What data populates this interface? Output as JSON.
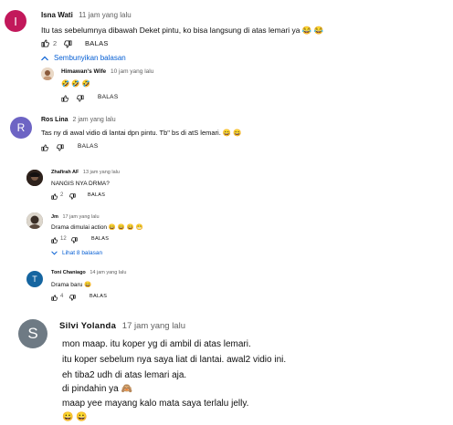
{
  "colors": {
    "link_blue": "#065fd4",
    "avatar_isna": "#c2185b",
    "avatar_ros": "#6d64c4",
    "avatar_toni": "#1565a0",
    "avatar_silvi": "#6e7a84",
    "meta_gray": "#606060"
  },
  "comments": [
    {
      "avatar_letter": "I",
      "author": "Isna Wati",
      "time": "11 jam yang lalu",
      "text": "Itu tas sebelumnya dibawah Deket pintu, ko bisa langsung di atas lemari ya 😂 😂",
      "likes": "2",
      "reply_label": "BALAS",
      "toggle_label": "Sembunyikan balasan",
      "toggle_icon": "chevron-up-icon",
      "replies": [
        {
          "author": "Himawan's Wife",
          "time": "10 jam yang lalu",
          "text": "🤣 🤣 🤣",
          "likes": "",
          "reply_label": "BALAS"
        }
      ]
    },
    {
      "avatar_letter": "R",
      "author": "Ros Lina",
      "time": "2 jam yang lalu",
      "text": "Tas ny di awal vidio di lantai dpn pintu. Tb\" bs di atS lemari.  😄 😄",
      "likes": "",
      "reply_label": "BALAS",
      "replies": [
        {
          "author": "Zhafirah AF",
          "time": "13 jam yang lalu",
          "text": "NANGIS NYA DRMA?",
          "likes": "2",
          "reply_label": "BALAS"
        },
        {
          "author": "Jm",
          "time": "17 jam yang lalu",
          "text": "Drama dimulai action 😄 😄 😄 😁",
          "likes": "12",
          "reply_label": "BALAS"
        }
      ],
      "more_replies_label": "Lihat 8 balasan",
      "more_replies_icon": "chevron-down-icon"
    },
    {
      "avatar_letter": "T",
      "author": "Toni Chaniago",
      "time": "14 jam yang lalu",
      "text": "Drama baru 😄",
      "likes": "4",
      "reply_label": "BALAS"
    },
    {
      "avatar_letter": "S",
      "author": "Silvi Yolanda",
      "time": "17 jam yang lalu",
      "lines": [
        "mon maap. itu koper yg di ambil di atas lemari.",
        "itu koper sebelum nya saya liat di lantai. awal2 vidio ini.",
        "eh tiba2 udh di atas lemari aja.",
        "di pindahin ya  🙈",
        "maap yee mayang kalo mata saya terlalu  jelly.",
        "😀 😀"
      ]
    }
  ]
}
